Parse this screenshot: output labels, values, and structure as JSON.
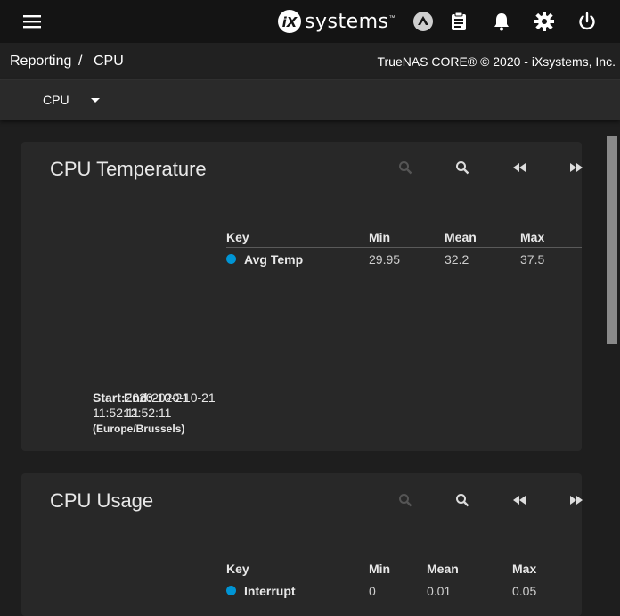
{
  "topbar": {
    "logo_text": "systems",
    "logo_mark": "iX",
    "logo_tm": "™",
    "icons": [
      "menu-icon",
      "truecommand-icon",
      "clipboard-icon",
      "bell-icon",
      "gear-icon",
      "power-icon"
    ]
  },
  "breadcrumb": {
    "root": "Reporting",
    "separator": "/",
    "current": "CPU",
    "copyright": "TrueNAS CORE® © 2020 - iXsystems, Inc."
  },
  "toolbar": {
    "selected": "CPU"
  },
  "cards": [
    {
      "title": "CPU Temperature",
      "legend": {
        "headers": {
          "key": "Key",
          "min": "Min",
          "mean": "Mean",
          "max": "Max"
        },
        "rows": [
          {
            "name": "Avg Temp",
            "min": "29.95",
            "mean": "32.2",
            "max": "37.5",
            "color": "#0095d5"
          }
        ]
      },
      "time": {
        "start_label": "Start:",
        "start_value": "2020-10-21",
        "end_label": "End:",
        "end_value": "2020-10-21",
        "start_time": "11:52:11",
        "end_time": "12:52:11",
        "timezone": "(Europe/Brussels)"
      }
    },
    {
      "title": "CPU Usage",
      "legend": {
        "headers": {
          "key": "Key",
          "min": "Min",
          "mean": "Mean",
          "max": "Max"
        },
        "rows": [
          {
            "name": "Interrupt",
            "min": "0",
            "mean": "0.01",
            "max": "0.05",
            "color": "#0095d5"
          }
        ]
      }
    }
  ]
}
